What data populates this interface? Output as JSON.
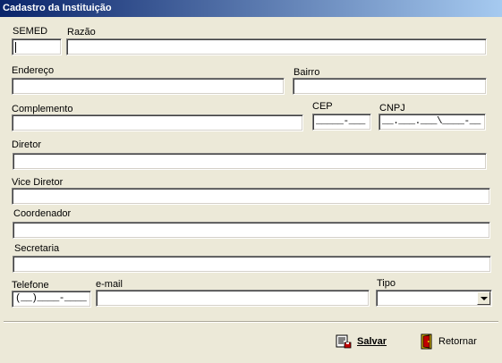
{
  "window": {
    "title": "Cadastro da Instituição"
  },
  "fields": {
    "semed": {
      "label": "SEMED",
      "value": ""
    },
    "razao": {
      "label": "Razão",
      "value": ""
    },
    "endereco": {
      "label": "Endereço",
      "value": ""
    },
    "bairro": {
      "label": "Bairro",
      "value": ""
    },
    "complemento": {
      "label": "Complemento",
      "value": ""
    },
    "cep": {
      "label": "CEP",
      "mask": "_____-___"
    },
    "cnpj": {
      "label": "CNPJ",
      "mask": "__.___.___\\____-__"
    },
    "diretor": {
      "label": "Diretor",
      "value": ""
    },
    "vice_diretor": {
      "label": "Vice Diretor",
      "value": ""
    },
    "coordenador": {
      "label": "Coordenador",
      "value": ""
    },
    "secretaria": {
      "label": "Secretaria",
      "value": ""
    },
    "telefone": {
      "label": "Telefone",
      "mask": "(__)____-____"
    },
    "email": {
      "label": "e-mail",
      "value": ""
    },
    "tipo": {
      "label": "Tipo",
      "value": ""
    }
  },
  "buttons": {
    "salvar": {
      "label": "Salvar",
      "icon": "save-icon"
    },
    "retornar": {
      "label": "Retornar",
      "icon": "exit-door-icon"
    }
  }
}
